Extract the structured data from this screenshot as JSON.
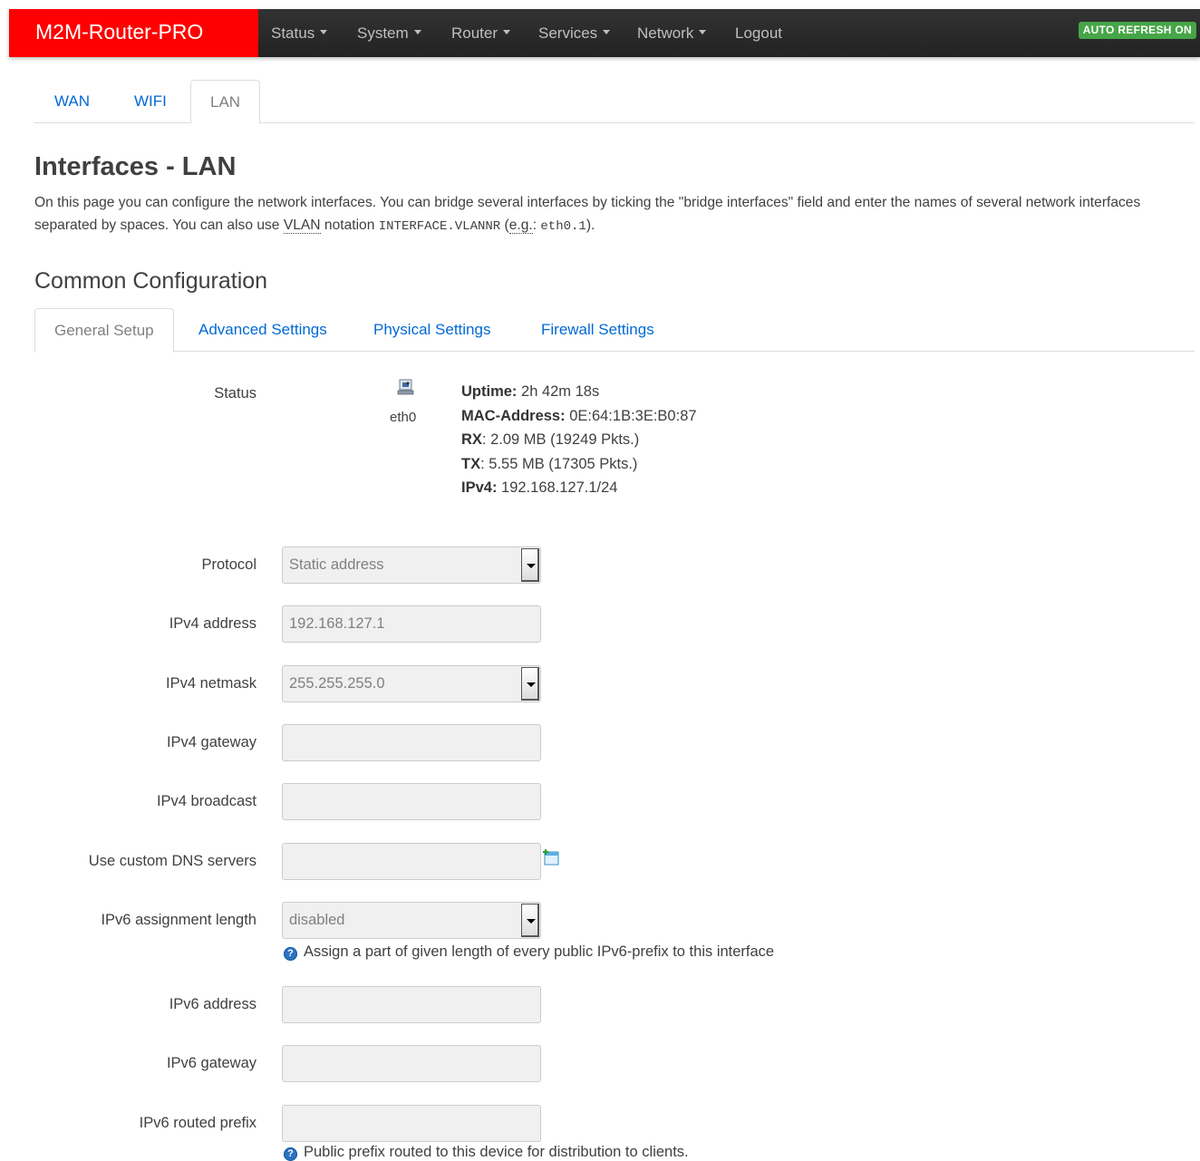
{
  "brand": "M2M-Router-PRO",
  "nav": {
    "items": [
      "Status",
      "System",
      "Router",
      "Services",
      "Network",
      "Logout"
    ],
    "auto_refresh": "AUTO REFRESH ON"
  },
  "page_tabs": [
    "WAN",
    "WIFI",
    "LAN"
  ],
  "active_page_tab": "LAN",
  "title": "Interfaces - LAN",
  "description": {
    "part1": "On this page you can configure the network interfaces. You can bridge several interfaces by ticking the \"bridge interfaces\" field and enter the names of several network interfaces separated by spaces. You can also use ",
    "vlan": "VLAN",
    "part2": " notation ",
    "code1": "INTERFACE.VLANNR",
    "part3": " (",
    "eg": "e.g.",
    "part4": ": ",
    "code2": "eth0.1",
    "part5": ")."
  },
  "section_title": "Common Configuration",
  "config_tabs": [
    "General Setup",
    "Advanced Settings",
    "Physical Settings",
    "Firewall Settings"
  ],
  "status": {
    "label": "Status",
    "iface": "eth0",
    "uptime_label": "Uptime:",
    "uptime": "2h 42m 18s",
    "mac_label": "MAC-Address:",
    "mac": "0E:64:1B:3E:B0:87",
    "rx_label": "RX",
    "rx": ": 2.09 MB (19249 Pkts.)",
    "tx_label": "TX",
    "tx": ": 5.55 MB (17305 Pkts.)",
    "ipv4_label": "IPv4:",
    "ipv4": "192.168.127.1/24"
  },
  "form": {
    "protocol": {
      "label": "Protocol",
      "value": "Static address"
    },
    "ipv4_address": {
      "label": "IPv4 address",
      "value": "192.168.127.1"
    },
    "ipv4_netmask": {
      "label": "IPv4 netmask",
      "value": "255.255.255.0"
    },
    "ipv4_gateway": {
      "label": "IPv4 gateway",
      "value": ""
    },
    "ipv4_broadcast": {
      "label": "IPv4 broadcast",
      "value": ""
    },
    "dns": {
      "label": "Use custom DNS servers",
      "value": ""
    },
    "ipv6_assign": {
      "label": "IPv6 assignment length",
      "value": "disabled",
      "help": "Assign a part of given length of every public IPv6-prefix to this interface"
    },
    "ipv6_address": {
      "label": "IPv6 address",
      "value": ""
    },
    "ipv6_gateway": {
      "label": "IPv6 gateway",
      "value": ""
    },
    "ipv6_prefix": {
      "label": "IPv6 routed prefix",
      "value": "",
      "help": "Public prefix routed to this device for distribution to clients."
    }
  },
  "colors": {
    "brand_bg": "#ff0000",
    "navbar_bg": "#2a2a2a",
    "link": "#0069d6",
    "auto_refresh_bg": "#46a546"
  }
}
